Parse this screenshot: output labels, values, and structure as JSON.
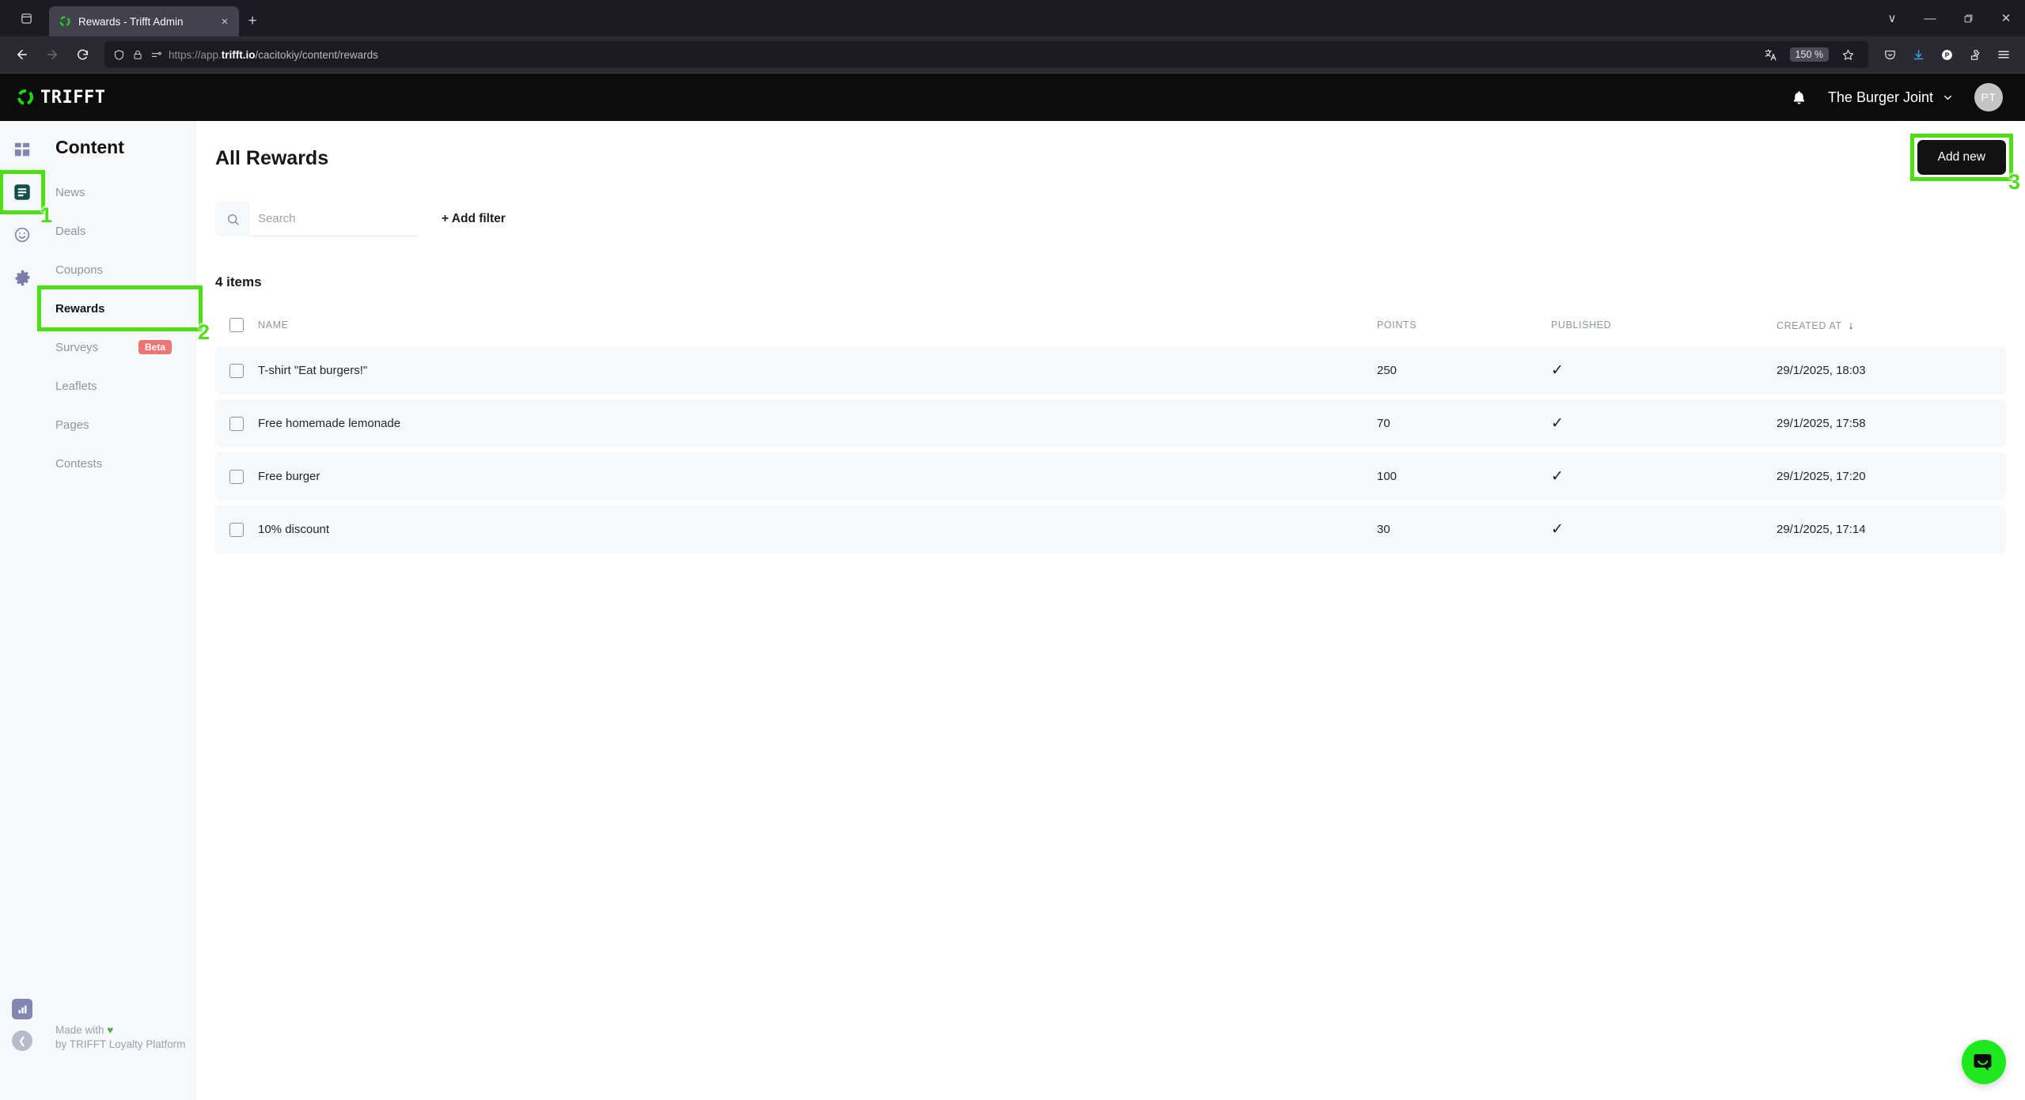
{
  "browser": {
    "tab": {
      "title": "Rewards - Trifft Admin",
      "favicon": "trifft-logo-icon",
      "close_label": "×"
    },
    "newtab_label": "+",
    "window_controls": {
      "list_all_tabs": "∨",
      "minimize": "—",
      "maximize": "❐",
      "close": "✕"
    },
    "url": {
      "scheme": "https://app.",
      "domain": "trifft.io",
      "path": "/cacitokiy/content/rewards"
    },
    "zoom_level": "150 %",
    "toolbar_icons": [
      "shield-icon",
      "lock-icon",
      "permissions-icon",
      "translate-icon",
      "bookmark-star-icon",
      "pocket-icon",
      "downloads-icon",
      "profile-icon",
      "extensions-icon",
      "menu-icon"
    ],
    "profile_initial": "P"
  },
  "appbar": {
    "brand": "TRIFFT",
    "notifications_icon": "bell-icon",
    "org_name": "The Burger Joint",
    "org_chevron": "⌄",
    "avatar_initials": "PT"
  },
  "sidebar": {
    "section_title": "Content",
    "rail": [
      {
        "name": "dashboard-grid-icon",
        "active": false
      },
      {
        "name": "content-document-icon",
        "active": true
      },
      {
        "name": "engagement-smiley-icon",
        "active": false
      },
      {
        "name": "settings-gear-icon",
        "active": false
      }
    ],
    "rail_bottom": [
      {
        "name": "analytics-chart-icon"
      },
      {
        "name": "collapse-sidebar-icon",
        "glyph": "❮"
      }
    ],
    "items": [
      {
        "label": "News",
        "active": false
      },
      {
        "label": "Deals",
        "active": false
      },
      {
        "label": "Coupons",
        "active": false
      },
      {
        "label": "Rewards",
        "active": true
      },
      {
        "label": "Surveys",
        "active": false,
        "badge": "Beta"
      },
      {
        "label": "Leaflets",
        "active": false
      },
      {
        "label": "Pages",
        "active": false
      },
      {
        "label": "Contests",
        "active": false
      }
    ],
    "footer": {
      "line1": "Made with",
      "heart": "♥",
      "line2": "by TRIFFT Loyalty Platform"
    }
  },
  "main": {
    "title": "All Rewards",
    "search_placeholder": "Search",
    "search_value": "",
    "search_icon": "search-icon",
    "add_filter_label": "+ Add filter",
    "add_new_label": "Add new",
    "item_count": "4 items",
    "columns": {
      "select": "",
      "name": "NAME",
      "points": "POINTS",
      "published": "PUBLISHED",
      "created_at": "CREATED AT"
    },
    "sort": {
      "column": "CREATED AT",
      "direction": "desc",
      "glyph": "↓"
    },
    "rows": [
      {
        "name": "T-shirt \"Eat burgers!\"",
        "points": "250",
        "published": "✓",
        "created_at": "29/1/2025, 18:03"
      },
      {
        "name": "Free homemade lemonade",
        "points": "70",
        "published": "✓",
        "created_at": "29/1/2025, 17:58"
      },
      {
        "name": "Free burger",
        "points": "100",
        "published": "✓",
        "created_at": "29/1/2025, 17:20"
      },
      {
        "name": "10% discount",
        "points": "30",
        "published": "✓",
        "created_at": "29/1/2025, 17:14"
      }
    ]
  },
  "chat_widget": {
    "icon": "chat-bubble-icon"
  },
  "annotations": [
    {
      "number": "1",
      "target": "content-document-icon"
    },
    {
      "number": "2",
      "target": "sidebar-item-rewards"
    },
    {
      "number": "3",
      "target": "add-new-button"
    }
  ],
  "colors": {
    "annotation_green": "#4ce014",
    "brand_green": "#1ee81e",
    "app_bar_black": "#0c0c0c",
    "beta_badge_red": "#ef7474",
    "sort_arrow_green": "#0f5132",
    "rail_icon_purple": "#8187b0",
    "active_icon_teal": "#14504a"
  }
}
